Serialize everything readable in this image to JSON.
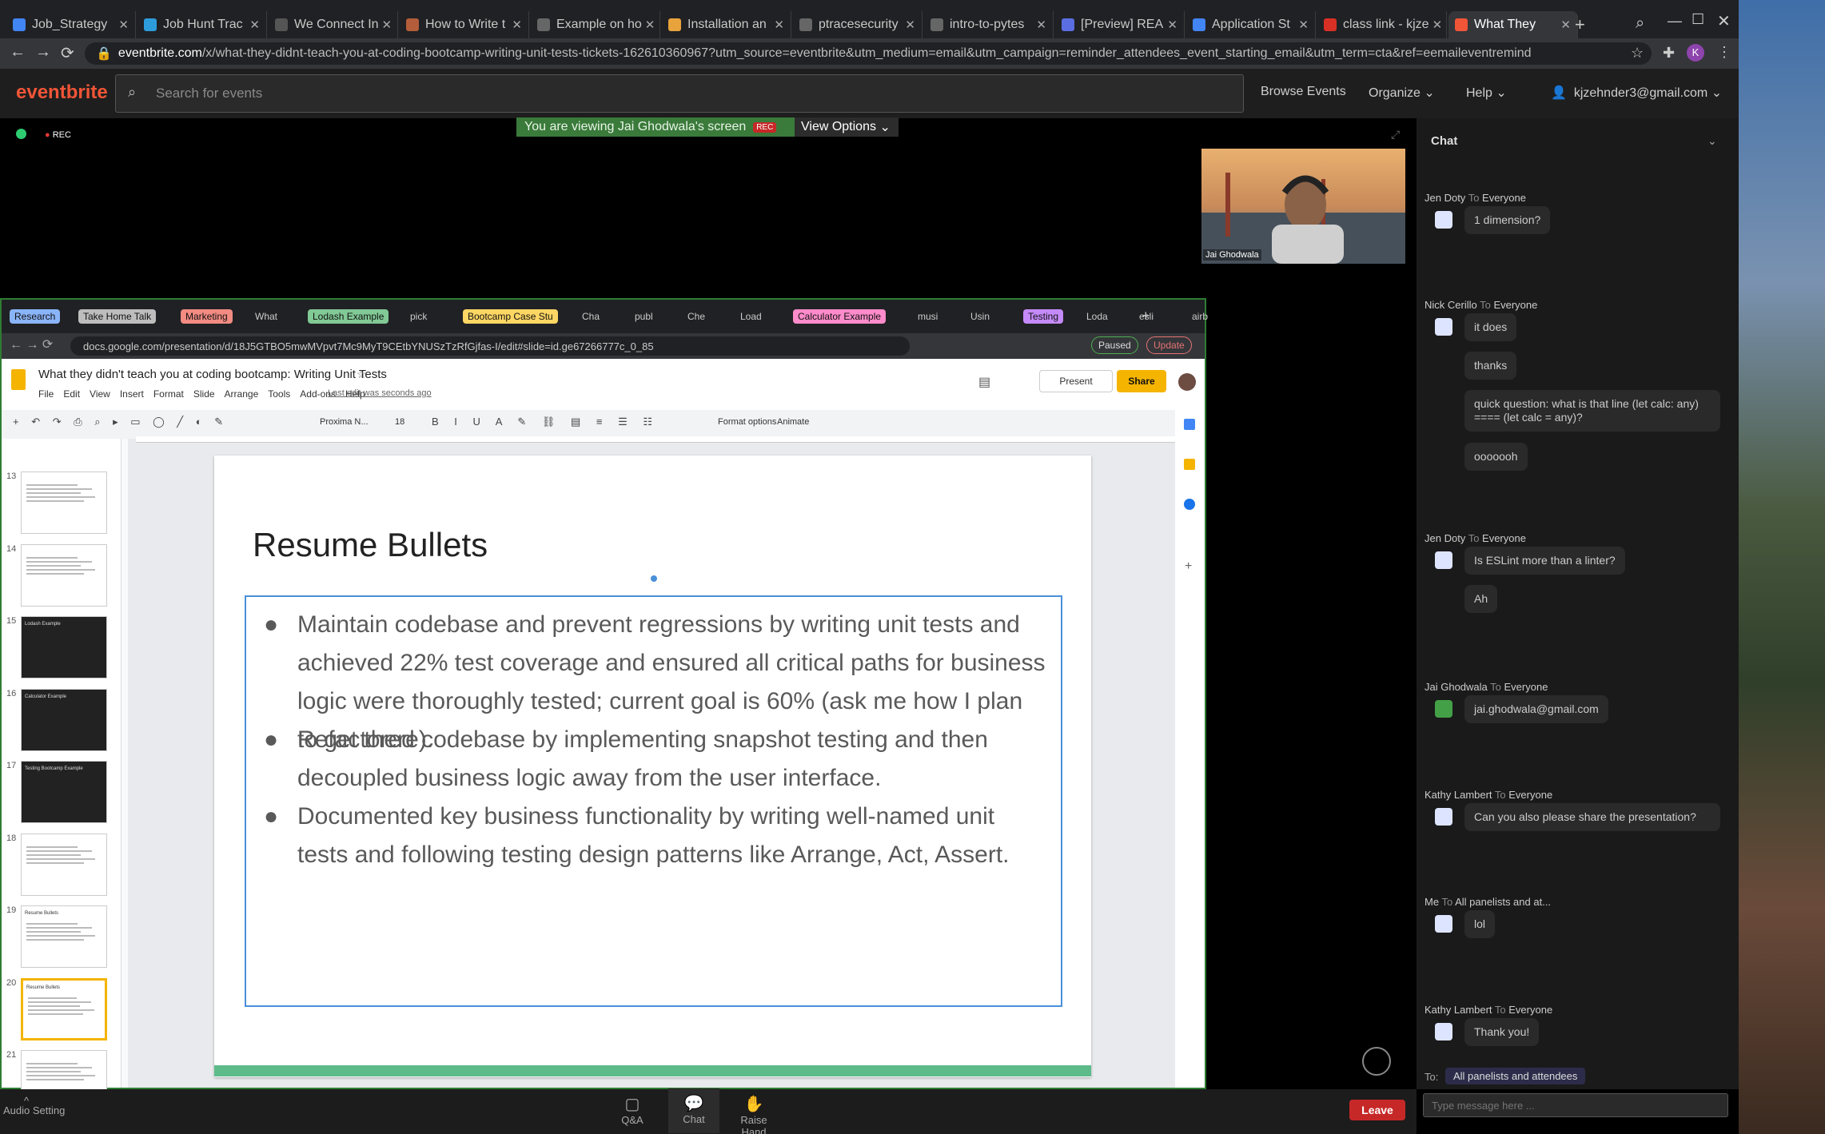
{
  "browser": {
    "tabs": [
      {
        "title": "Job_Strategy",
        "color": "#4285f4"
      },
      {
        "title": "Job Hunt Trac",
        "color": "#2d9cdb"
      },
      {
        "title": "We Connect In",
        "color": "#555555"
      },
      {
        "title": "How to Write t",
        "color": "#b35d3a"
      },
      {
        "title": "Example on ho",
        "color": "#666666"
      },
      {
        "title": "Installation an",
        "color": "#e8a33d"
      },
      {
        "title": "ptracesecurity",
        "color": "#666666"
      },
      {
        "title": "intro-to-pytes",
        "color": "#666666"
      },
      {
        "title": "[Preview] REA",
        "color": "#5b6ee1"
      },
      {
        "title": "Application St",
        "color": "#4285f4"
      },
      {
        "title": "class link - kjze",
        "color": "#d93025"
      },
      {
        "title": "What They",
        "color": "#f05537"
      }
    ],
    "url_host": "eventbrite.com",
    "url_path": "/x/what-they-didnt-teach-you-at-coding-bootcamp-writing-unit-tests-tickets-162610360967?utm_source=eventbrite&utm_medium=email&utm_campaign=reminder_attendees_event_starting_email&utm_term=cta&ref=eemaileventremind"
  },
  "eventbrite": {
    "logo": "eventbrite",
    "search_placeholder": "Search for events",
    "nav": [
      "Browse Events",
      "Organize",
      "Help"
    ],
    "user": "kjzehnder3@gmail.com"
  },
  "zoom": {
    "rec": "REC",
    "banner": "You are viewing Jai Ghodwala's screen",
    "banner_rec": "REC",
    "view_options": "View Options",
    "presenter_name": "Jai Ghodwala",
    "bottom": {
      "qa": "Q&A",
      "chat": "Chat",
      "raise_hand": "Raise Hand",
      "leave": "Leave",
      "audio": "Audio Setting"
    }
  },
  "shared": {
    "tabs": [
      {
        "label": "Research",
        "pill": "#8ab4f8"
      },
      {
        "label": "Take Home Talk",
        "pill": "#bdbdbd"
      },
      {
        "label": "Marketing",
        "pill": "#f28b82"
      },
      {
        "label": "What",
        "pill": ""
      },
      {
        "label": "Lodash Example",
        "pill": "#81c995"
      },
      {
        "label": "pick",
        "pill": ""
      },
      {
        "label": "Bootcamp Case Stu",
        "pill": "#fdd663"
      },
      {
        "label": "Cha",
        "pill": ""
      },
      {
        "label": "publ",
        "pill": ""
      },
      {
        "label": "Che",
        "pill": ""
      },
      {
        "label": "Load",
        "pill": ""
      },
      {
        "label": "Calculator Example",
        "pill": "#ff8bcb"
      },
      {
        "label": "musi",
        "pill": ""
      },
      {
        "label": "Usin",
        "pill": ""
      },
      {
        "label": "Testing",
        "pill": "#c58af9"
      },
      {
        "label": "Loda",
        "pill": ""
      },
      {
        "label": "esli",
        "pill": ""
      },
      {
        "label": "airb",
        "pill": ""
      }
    ],
    "url": "docs.google.com/presentation/d/18J5GTBO5mwMVpvt7Mc9MyT9CEtbYNUSzTzRfGjfas-I/edit#slide=id.ge67266777c_0_85",
    "paused": "Paused",
    "update": "Update",
    "doc_title": "What they didn't teach you at coding bootcamp: Writing Unit Tests",
    "menus": [
      "File",
      "Edit",
      "View",
      "Insert",
      "Format",
      "Slide",
      "Arrange",
      "Tools",
      "Add-ons",
      "Help"
    ],
    "last_edit": "Last edit was seconds ago",
    "present": "Present",
    "share": "Share",
    "font_name": "Proxima N...",
    "font_size": "18",
    "format_options": "Format options",
    "animate": "Animate",
    "slide_numbers": [
      "13",
      "14",
      "15",
      "16",
      "17",
      "18",
      "19",
      "20",
      "21"
    ],
    "thumb_titles": [
      "",
      "",
      "Lodash Example",
      "Calculator Example",
      "Testing Bootcamp Example",
      "",
      "Resume Bullets",
      "Resume Bullets",
      ""
    ],
    "slide": {
      "title": "Resume Bullets",
      "bullets": [
        "Maintain codebase and prevent regressions by writing unit tests and achieved 22% test coverage and ensured all critical paths for business logic were thoroughly tested; current goal is 60% (ask me how I plan to get there).",
        "Refactored codebase by implementing snapshot testing and then decoupled business logic away from the user interface.",
        "Documented key business functionality by writing well-named unit tests and following testing design patterns like Arrange, Act, Assert."
      ]
    }
  },
  "chat": {
    "title": "Chat",
    "messages": [
      {
        "from": "Jen Doty",
        "to": "Everyone",
        "texts": [
          "1 dimension?"
        ]
      },
      {
        "from": "Nick Cerillo",
        "to": "Everyone",
        "texts": [
          "it does",
          "thanks",
          "quick question: what is that line (let calc: any) ==== (let calc = any)?",
          "ooooooh"
        ]
      },
      {
        "from": "Jen Doty",
        "to": "Everyone",
        "texts": [
          "Is ESLint more than a linter?",
          "Ah"
        ]
      },
      {
        "from": "Jai Ghodwala",
        "to": "Everyone",
        "texts": [
          "jai.ghodwala@gmail.com"
        ]
      },
      {
        "from": "Kathy Lambert",
        "to": "Everyone",
        "texts": [
          "Can you also please share the presentation?"
        ]
      },
      {
        "from": "Me",
        "to": "All panelists and at...",
        "texts": [
          "lol"
        ]
      },
      {
        "from": "Kathy Lambert",
        "to": "Everyone",
        "texts": [
          "Thank you!"
        ]
      }
    ],
    "to_label": "To:",
    "to_value": "All panelists and attendees",
    "input_placeholder": "Type message here ..."
  }
}
